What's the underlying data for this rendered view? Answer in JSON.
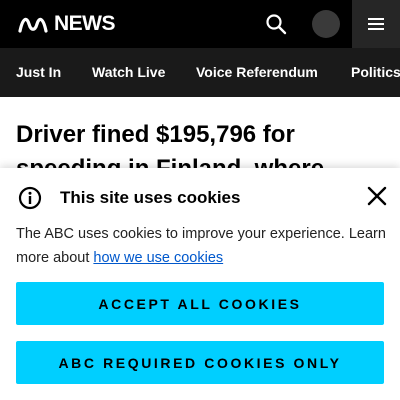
{
  "header": {
    "logo_text": "NEWS",
    "colors": {
      "background": "#000000",
      "menu_bg": "#262626",
      "avatar": "#3a3a3a"
    },
    "icons": {
      "search": "search-icon",
      "menu": "hamburger-menu-icon",
      "logo": "abc-logo-icon"
    }
  },
  "nav": {
    "items": [
      {
        "label": "Just In"
      },
      {
        "label": "Watch Live"
      },
      {
        "label": "Voice Referendum"
      },
      {
        "label": "Politics"
      }
    ],
    "background": "#1a1a1a"
  },
  "article": {
    "title": "Driver fined $195,796 for speeding in Finland, where"
  },
  "cookie_banner": {
    "title": "This site uses cookies",
    "text": "The ABC uses cookies to improve your experience. Learn more about ",
    "link_text": "how we use cookies",
    "accept_all_label": "ACCEPT ALL COOKIES",
    "required_only_label": "ABC REQUIRED COOKIES ONLY",
    "button_color": "#00cfff",
    "link_color": "#0058cc",
    "icons": {
      "info": "info-icon",
      "close": "close-icon"
    }
  }
}
